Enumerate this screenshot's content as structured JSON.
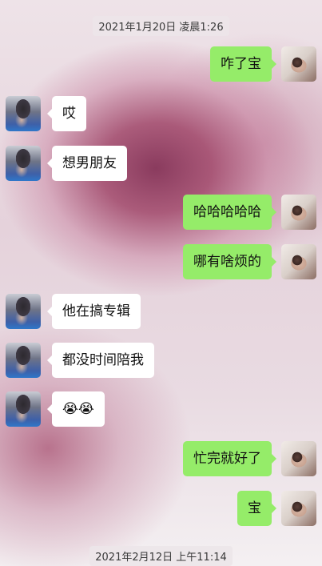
{
  "timestamps": {
    "first": "2021年1月20日 凌晨1:26",
    "second": "2021年2月12日 上午11:14"
  },
  "messages": [
    {
      "sender": "me",
      "text": "咋了宝"
    },
    {
      "sender": "them",
      "text": "哎"
    },
    {
      "sender": "them",
      "text": "想男朋友"
    },
    {
      "sender": "me",
      "text": "哈哈哈哈哈"
    },
    {
      "sender": "me",
      "text": "哪有啥烦的"
    },
    {
      "sender": "them",
      "text": "他在搞专辑"
    },
    {
      "sender": "them",
      "text": "都没时间陪我"
    },
    {
      "sender": "them",
      "text": "😭😭"
    },
    {
      "sender": "me",
      "text": "忙完就好了"
    },
    {
      "sender": "me",
      "text": "宝"
    }
  ],
  "colors": {
    "outgoing_bubble": "#95ec69",
    "incoming_bubble": "#ffffff"
  }
}
